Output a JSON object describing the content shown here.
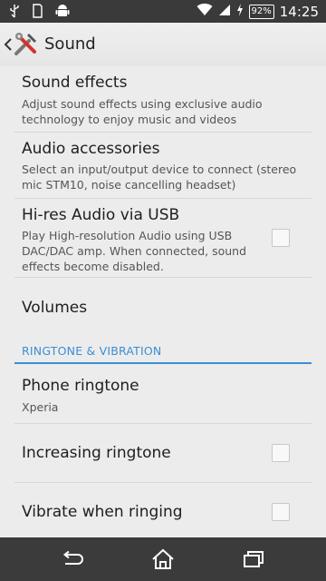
{
  "status_bar": {
    "time": "14:25",
    "battery_percent": "92%",
    "icons": [
      "usb-icon",
      "sd-card-icon",
      "android-debug-icon",
      "wifi-icon",
      "signal-icon",
      "charging-icon",
      "battery-icon"
    ]
  },
  "action_bar": {
    "title": "Sound",
    "back_icon": "chevron-left-icon",
    "app_icon": "settings-tools-icon"
  },
  "settings": {
    "sound_effects": {
      "title": "Sound effects",
      "summary": "Adjust sound effects using exclusive audio technology to enjoy music and videos"
    },
    "audio_accessories": {
      "title": "Audio accessories",
      "summary": "Select an input/output device to connect (stereo mic STM10, noise cancelling headset)"
    },
    "hires_audio": {
      "title": "Hi-res Audio via USB",
      "summary": "Play High-resolution Audio using USB DAC/DAC amp. When connected, sound effects become disabled.",
      "checked": false
    },
    "volumes": {
      "title": "Volumes"
    },
    "section_header": "RINGTONE & VIBRATION",
    "phone_ringtone": {
      "title": "Phone ringtone",
      "summary": "Xperia"
    },
    "increasing_ringtone": {
      "title": "Increasing ringtone",
      "checked": false
    },
    "vibrate_when_ringing": {
      "title": "Vibrate when ringing",
      "checked": false
    }
  },
  "nav_bar": {
    "back": "back-icon",
    "home": "home-icon",
    "recents": "recents-icon"
  },
  "colors": {
    "accent": "#3a8ed6",
    "background": "#ececec",
    "status_bar": "#3a3a3a",
    "nav_bar": "#3b3b3b"
  }
}
